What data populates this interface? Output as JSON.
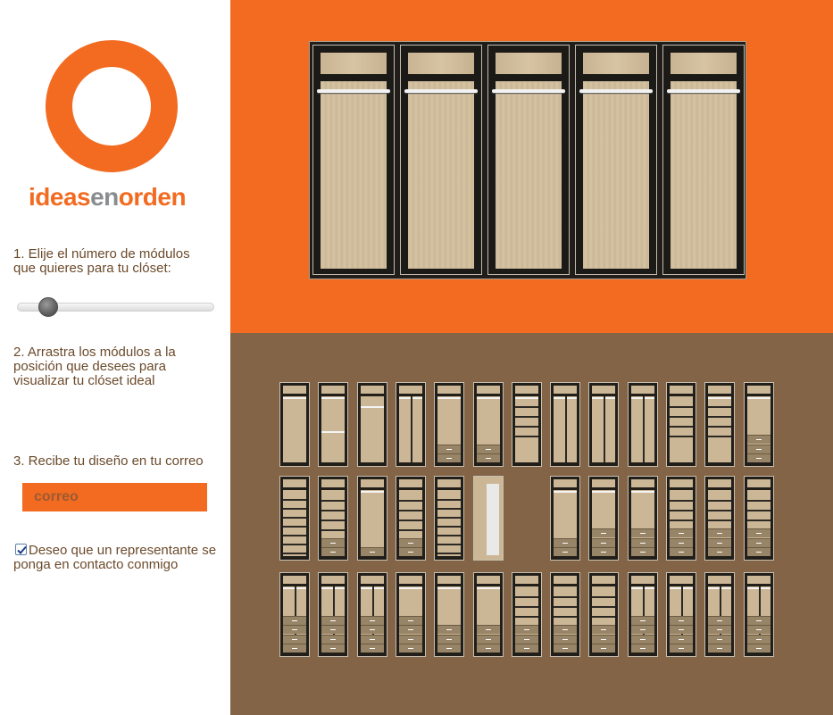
{
  "brand": {
    "logo_color": "#f26b21",
    "name_part1": "ideas",
    "name_part2": "en",
    "name_part3": "orden"
  },
  "steps": {
    "step1": "1. Elije el número de módulos que quieres para tu clóset:",
    "step2": "2. Arrastra los módulos a la posición que desees para visualizar tu clóset ideal",
    "step3": "3. Recibe tu diseño en tu correo"
  },
  "slider": {
    "value_fraction": 0.12
  },
  "email": {
    "placeholder": "correo",
    "value": ""
  },
  "contact": {
    "checked": true,
    "label": "Deseo que un representante se ponga en contacto conmigo"
  },
  "closet_preview": {
    "module_count": 5,
    "modules": [
      "rail",
      "rail",
      "rail",
      "rail",
      "rail"
    ]
  },
  "colors": {
    "accent": "#f26b21",
    "palette_bg": "#846447",
    "text": "#6b4a2b"
  },
  "palette": {
    "rows": [
      [
        "rail-full",
        "rail-shelf-low",
        "rail-high",
        "half-split",
        "rail-drawers",
        "rail-drawers-wide",
        "shelves-rail",
        "split-rail",
        "split-rail",
        "split-rail",
        "shelves",
        "rail-shelves",
        "rail-drawers-3"
      ],
      [
        "shelves-full",
        "shelves-drawers",
        "rail-drawer",
        "shelves-drawers",
        "shelves-full",
        "door-mirror",
        "empty",
        "hanger-drawers",
        "rail-drawers-3",
        "rail-drawers-3",
        "shelves-drawers-3",
        "shelves-drawers-3",
        "shelves-drawers-3"
      ],
      [
        "split-drawers",
        "split-drawers",
        "split-drawers",
        "rail-drawers-4",
        "rail-drawers-3",
        "rail-drawers-3",
        "shelves-drawers-3",
        "shelves-drawers-3",
        "shelves-drawers-3",
        "split-drawers",
        "split-drawers",
        "split-drawers",
        "split-drawers"
      ]
    ]
  }
}
